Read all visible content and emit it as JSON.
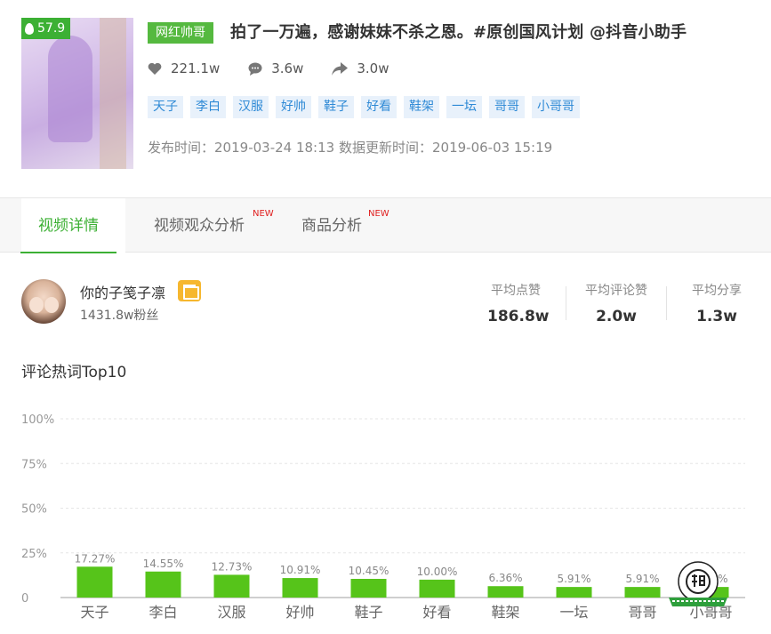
{
  "video": {
    "score": "57.9",
    "category": "网红帅哥",
    "title": "拍了一万遍，感谢妹妹不杀之恩。#原创国风计划 @抖音小助手",
    "stats": {
      "likes": "221.1w",
      "comments": "3.6w",
      "shares": "3.0w"
    },
    "tags": [
      "天子",
      "李白",
      "汉服",
      "好帅",
      "鞋子",
      "好看",
      "鞋架",
      "一坛",
      "哥哥",
      "小哥哥"
    ],
    "publish_label": "发布时间：",
    "publish_time": "2019-03-24 18:13",
    "update_label": "数据更新时间：",
    "update_time": "2019-06-03 15:19"
  },
  "tabs": [
    {
      "label": "视频详情",
      "active": true,
      "badge": ""
    },
    {
      "label": "视频观众分析",
      "active": false,
      "badge": "NEW"
    },
    {
      "label": "商品分析",
      "active": false,
      "badge": "NEW"
    }
  ],
  "author": {
    "name": "你的子笺子凛",
    "fans": "1431.8w粉丝",
    "averages": [
      {
        "label": "平均点赞",
        "value": "186.8w"
      },
      {
        "label": "平均评论赞",
        "value": "2.0w"
      },
      {
        "label": "平均分享",
        "value": "1.3w"
      }
    ]
  },
  "section_title": "评论热词Top10",
  "colors": {
    "green": "#3cb034",
    "bar": "#56c41a",
    "tag_bg": "#e8f1fb",
    "tag_text": "#2f8ad6"
  },
  "chart_data": {
    "type": "bar",
    "categories": [
      "天子",
      "李白",
      "汉服",
      "好帅",
      "鞋子",
      "好看",
      "鞋架",
      "一坛",
      "哥哥",
      "小哥哥"
    ],
    "values": [
      17.27,
      14.55,
      12.73,
      10.91,
      10.45,
      10.0,
      6.36,
      5.91,
      5.91,
      5.91
    ],
    "value_labels": [
      "17.27%",
      "14.55%",
      "12.73%",
      "10.91%",
      "10.45%",
      "10.00%",
      "6.36%",
      "5.91%",
      "5.91%",
      "5.91%"
    ],
    "y_ticks": [
      "0",
      "25%",
      "50%",
      "75%",
      "100%"
    ],
    "ylim": [
      0,
      100
    ],
    "grid": true
  }
}
